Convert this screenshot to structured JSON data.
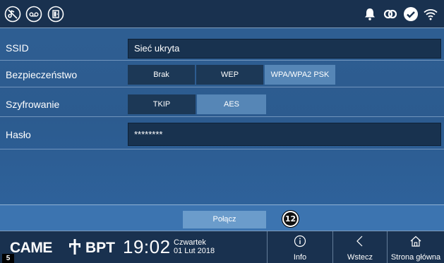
{
  "topbar": {
    "left_icons": [
      "mute-icon",
      "voicemail-icon",
      "door-open-icon"
    ],
    "right_icons": [
      "bell-icon",
      "link-icon",
      "check-circle-icon",
      "wifi-icon"
    ]
  },
  "form": {
    "ssid": {
      "label": "SSID",
      "value": "Sieć ukryta"
    },
    "security": {
      "label": "Bezpieczeństwo",
      "options": [
        "Brak",
        "WEP",
        "WPA/WPA2 PSK"
      ],
      "selected": "WPA/WPA2 PSK"
    },
    "encryption": {
      "label": "Szyfrowanie",
      "options": [
        "TKIP",
        "AES"
      ],
      "selected": "AES"
    },
    "password": {
      "label": "Hasło",
      "value": "********"
    }
  },
  "connect": {
    "label": "Połącz",
    "callout": "12"
  },
  "bottombar": {
    "brand_left": "CAME",
    "brand_right": "BPT",
    "page_badge": "5",
    "time": "19:02",
    "day": "Czwartek",
    "date": "01 Lut 2018",
    "nav": [
      {
        "label": "Info",
        "icon": "info-icon"
      },
      {
        "label": "Wstecz",
        "icon": "back-chevron-icon"
      },
      {
        "label": "Strona główna",
        "icon": "home-icon"
      }
    ]
  },
  "colors": {
    "bar_background": "#19314f",
    "panel_background": "#2f5f93",
    "field_background": "#18324f",
    "selected_segment": "#5686b6",
    "connect_button": "#6b9ccb"
  }
}
